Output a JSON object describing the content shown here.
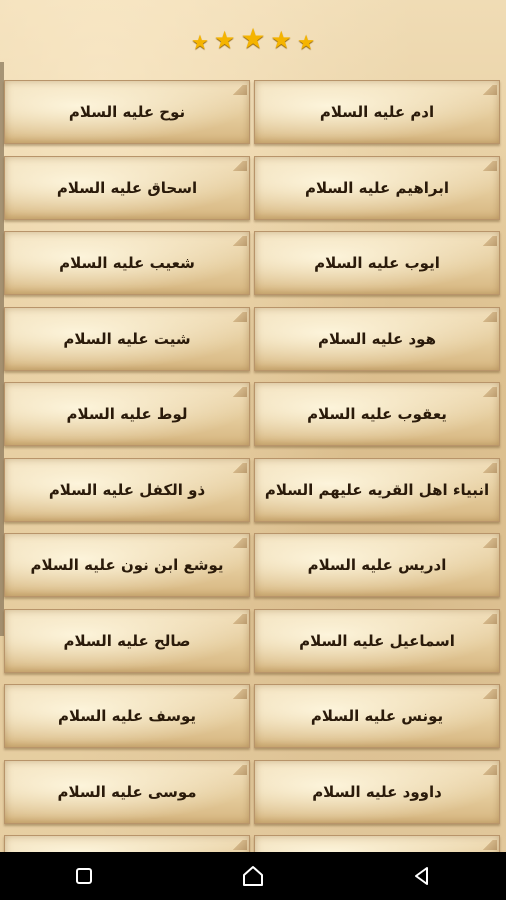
{
  "rating": {
    "stars": 5,
    "star_color": "#f5b400"
  },
  "items": [
    {
      "label": "ادم عليه السلام"
    },
    {
      "label": "نوح عليه السلام"
    },
    {
      "label": "ابراهيم عليه السلام"
    },
    {
      "label": "اسحاق عليه السلام"
    },
    {
      "label": "ايوب عليه السلام"
    },
    {
      "label": "شعيب عليه السلام"
    },
    {
      "label": "هود عليه السلام"
    },
    {
      "label": "شيت عليه السلام"
    },
    {
      "label": "يعقوب عليه السلام"
    },
    {
      "label": "لوط عليه السلام"
    },
    {
      "label": "انبياء اهل القريه عليهم السلام"
    },
    {
      "label": "ذو الكفل عليه السلام"
    },
    {
      "label": "ادريس عليه السلام"
    },
    {
      "label": "يوشع ابن نون عليه السلام"
    },
    {
      "label": "اسماعيل عليه السلام"
    },
    {
      "label": "صالح عليه السلام"
    },
    {
      "label": "يونس عليه السلام"
    },
    {
      "label": "يوسف عليه السلام"
    },
    {
      "label": "داوود عليه السلام"
    },
    {
      "label": "موسى عليه السلام"
    }
  ],
  "navbar": {
    "buttons": [
      {
        "name": "recents",
        "icon": "square-icon"
      },
      {
        "name": "home",
        "icon": "circle-icon"
      },
      {
        "name": "back",
        "icon": "triangle-back-icon"
      }
    ]
  }
}
